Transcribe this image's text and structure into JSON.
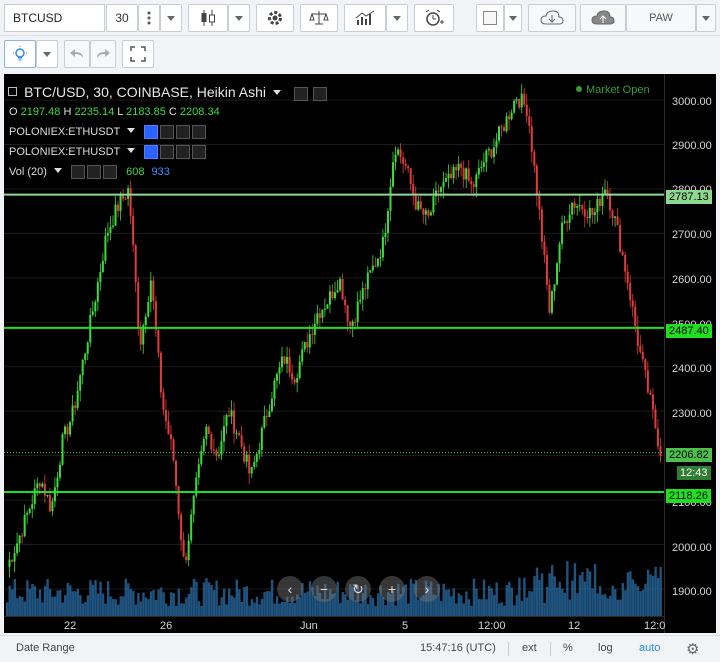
{
  "toolbar": {
    "symbol": "BTCUSD",
    "interval": "30",
    "account_label": "PAW"
  },
  "legend": {
    "title": "BTC/USD, 30, COINBASE, Heikin Ashi",
    "ohlc": [
      {
        "label": "O",
        "value": "2197.48"
      },
      {
        "label": "H",
        "value": "2235.14"
      },
      {
        "label": "L",
        "value": "2183.85"
      },
      {
        "label": "C",
        "value": "2208.34"
      }
    ],
    "indicators": [
      {
        "name": "POLONIEX:ETHUSDT"
      },
      {
        "name": "POLONIEX:ETHUSDT"
      }
    ],
    "volume": {
      "name": "Vol (20)",
      "value_a": "608",
      "value_b": "933"
    },
    "market_status": "Market Open"
  },
  "price_axis": {
    "ticks": [
      "3000.00",
      "2900.00",
      "2800.00",
      "2700.00",
      "2600.00",
      "2500.00",
      "2400.00",
      "2300.00",
      "2200.00",
      "2100.00",
      "2000.00",
      "1900.00"
    ]
  },
  "price_labels": [
    {
      "value": "2787.13"
    },
    {
      "value": "2487.40"
    },
    {
      "value": "2206.82"
    },
    {
      "value": "12:43"
    },
    {
      "value": "2118.26"
    }
  ],
  "time_axis": {
    "ticks": [
      "22",
      "26",
      "Jun",
      "5",
      "12:00",
      "12",
      "12:0"
    ]
  },
  "statusbar": {
    "date_range": "Date Range",
    "time": "15:47:16 (UTC)",
    "ext": "ext",
    "percent": "%",
    "log": "log",
    "auto": "auto"
  },
  "colors": {
    "up": "#3cdc3c",
    "down": "#e03c3c",
    "hline": "#1ee01e",
    "volume": "#2a6fa8"
  },
  "chart_data": {
    "type": "candlestick",
    "title": "BTC/USD, 30, COINBASE, Heikin Ashi",
    "ylim": [
      1860,
      3060
    ],
    "x_ticks": [
      "22",
      "26",
      "Jun",
      "5",
      "12:00",
      "12",
      "12:0"
    ],
    "horizontal_lines": [
      2787.13,
      2487.4,
      2118.26
    ],
    "last_price": 2206.82,
    "series": [
      {
        "name": "BTC/USD",
        "values": [
          1950,
          2010,
          2080,
          2150,
          2080,
          2230,
          2300,
          2430,
          2560,
          2700,
          2760,
          2800,
          2450,
          2600,
          2320,
          2200,
          1950,
          2120,
          2260,
          2200,
          2300,
          2240,
          2150,
          2250,
          2350,
          2420,
          2380,
          2450,
          2520,
          2550,
          2600,
          2490,
          2560,
          2620,
          2680,
          2900,
          2850,
          2760,
          2730,
          2800,
          2820,
          2850,
          2800,
          2860,
          2900,
          2950,
          3010,
          2980,
          2760,
          2520,
          2700,
          2770,
          2760,
          2740,
          2810,
          2720,
          2600,
          2450,
          2330,
          2210
        ]
      }
    ]
  }
}
